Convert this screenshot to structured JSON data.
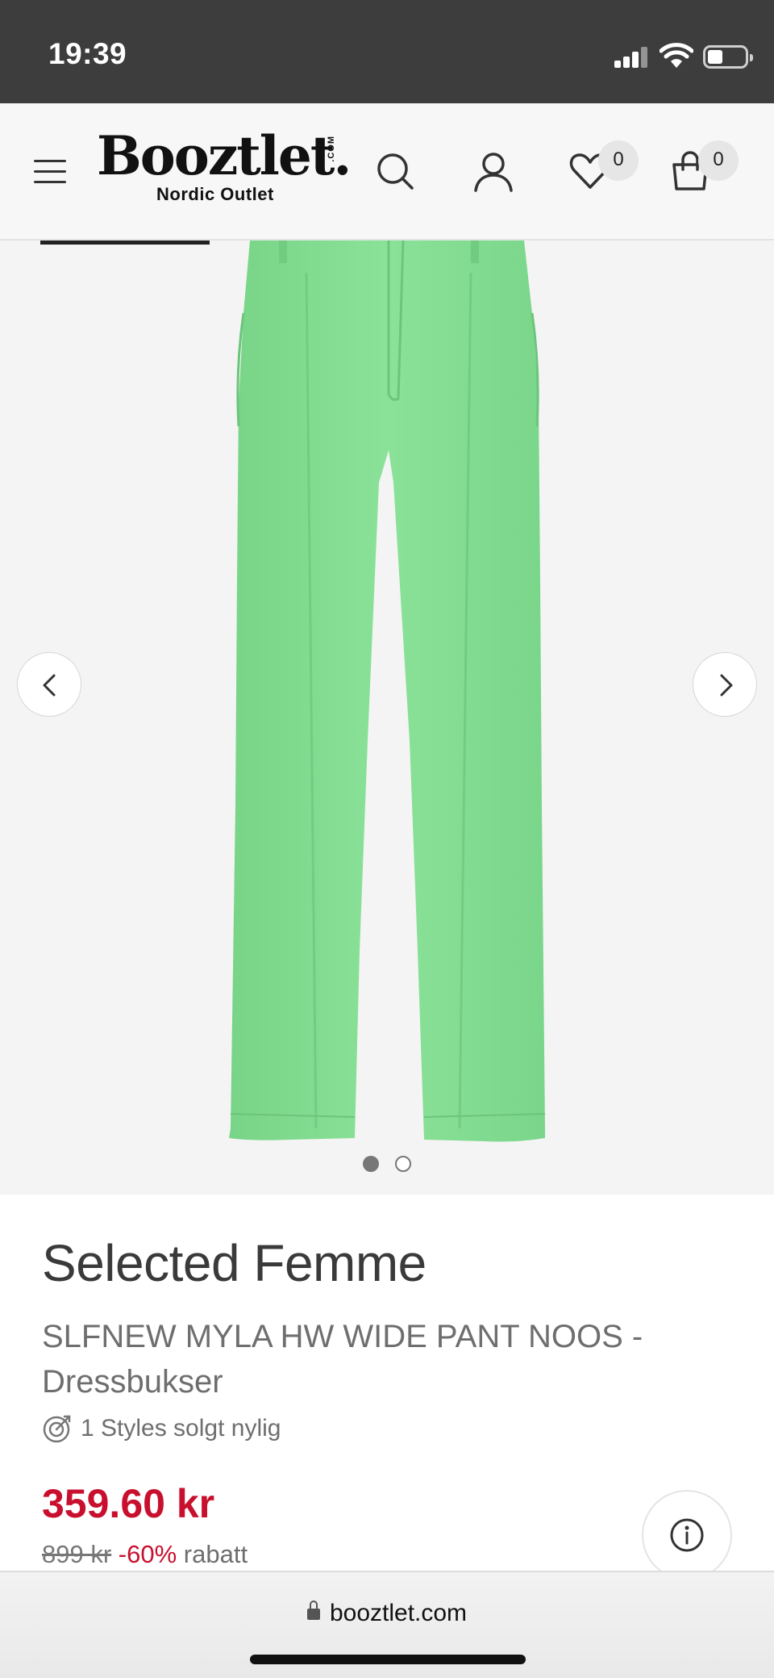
{
  "status_bar": {
    "time": "19:39",
    "icons": [
      "signal-icon",
      "wifi-icon",
      "battery-icon"
    ]
  },
  "header": {
    "logo_text": "Booztlet.",
    "logo_com": ".COM",
    "logo_subtitle": "Nordic Outlet",
    "icons": [
      "menu-icon",
      "search-icon",
      "account-icon",
      "heart-icon",
      "bag-icon"
    ],
    "wishlist_count": "0",
    "cart_count": "0"
  },
  "gallery": {
    "image_description_icon": "green-wide-pants",
    "nav_icons": [
      "chevron-left-icon",
      "chevron-right-icon"
    ],
    "active_slide": 1,
    "slide_count": 2
  },
  "product": {
    "brand": "Selected Femme",
    "name": "SLFNEW MYLA HW WIDE PANT NOOS - Dressbukser",
    "sold_recently": "1 Styles solgt nylig",
    "price": "359.60 kr",
    "old_price": "899 kr",
    "discount": "-60%",
    "discount_suffix": "rabatt"
  },
  "browser": {
    "url": "booztlet.com"
  },
  "colors": {
    "accent_red": "#c8102e",
    "status_bar": "#3d3d3d",
    "pants_green": "#82dc90"
  }
}
